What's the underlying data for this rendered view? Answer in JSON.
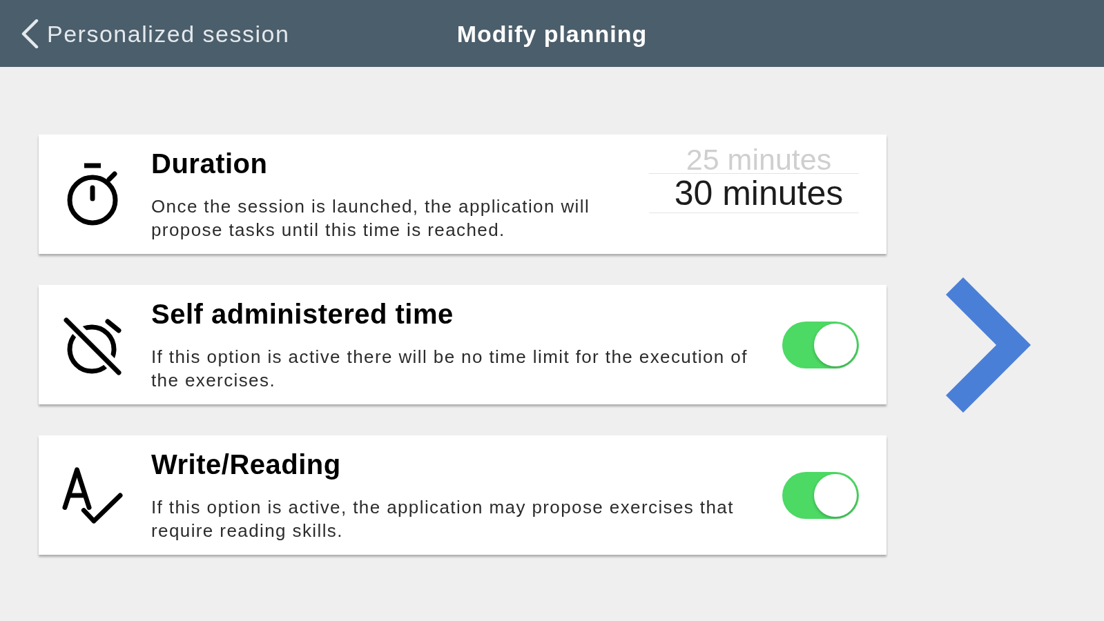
{
  "top_bar": {
    "back_label": "Personalized session",
    "title": "Modify planning"
  },
  "settings": [
    {
      "kind": "picker",
      "title": "Duration",
      "description": "Once the session is launched, the application will propose tasks until this time is reached.",
      "options": [
        {
          "label": "25 minutes",
          "selected": false
        },
        {
          "label": "30 minutes",
          "selected": true
        }
      ]
    },
    {
      "kind": "toggle",
      "title": "Self administered time",
      "description": "If this option is active there will be no time limit for the execution of the exercises.",
      "on": true
    },
    {
      "kind": "toggle",
      "title": "Write/Reading",
      "description": "If this option is active, the application may propose exercises that require reading skills.",
      "on": true
    }
  ]
}
